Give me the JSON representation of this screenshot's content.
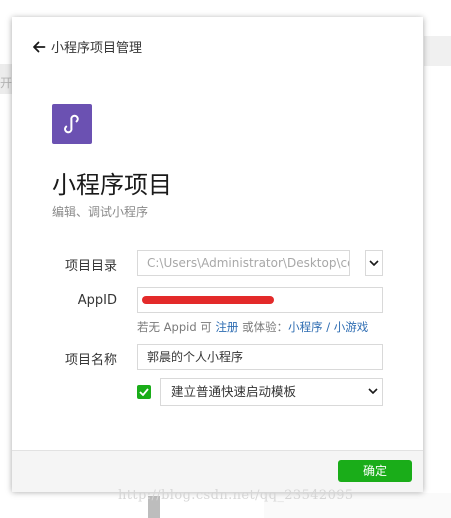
{
  "background": {
    "left_fragment": "开",
    "watermark": "http://blog.csdn.net/qq_23542095"
  },
  "dialog": {
    "back_label": "小程序项目管理",
    "title": "小程序项目",
    "subtitle": "编辑、调试小程序",
    "form": {
      "project_dir_label": "项目目录",
      "project_dir_value": "C:\\Users\\Administrator\\Desktop\\cotte",
      "appid_label": "AppID",
      "appid_value": "",
      "hint_prefix": "若无 Appid 可 ",
      "hint_register": "注册",
      "hint_middle": " 或体验：",
      "hint_miniprogram": "小程序",
      "hint_sep": " / ",
      "hint_minigame": "小游戏",
      "project_name_label": "项目名称",
      "project_name_value": "郭晨的个人小程序",
      "template_checked": true,
      "template_selected": "建立普通快速启动模板"
    },
    "confirm_label": "确定"
  },
  "colors": {
    "accent_green": "#1aad19",
    "icon_purple": "#6b51b2",
    "link_blue": "#2d6cb2",
    "redaction_red": "#e32a2a"
  },
  "icons": {
    "back": "arrow-left-icon",
    "app": "mini-program-logo-icon",
    "dropdown": "chevron-down-icon",
    "check": "checkmark-icon"
  }
}
